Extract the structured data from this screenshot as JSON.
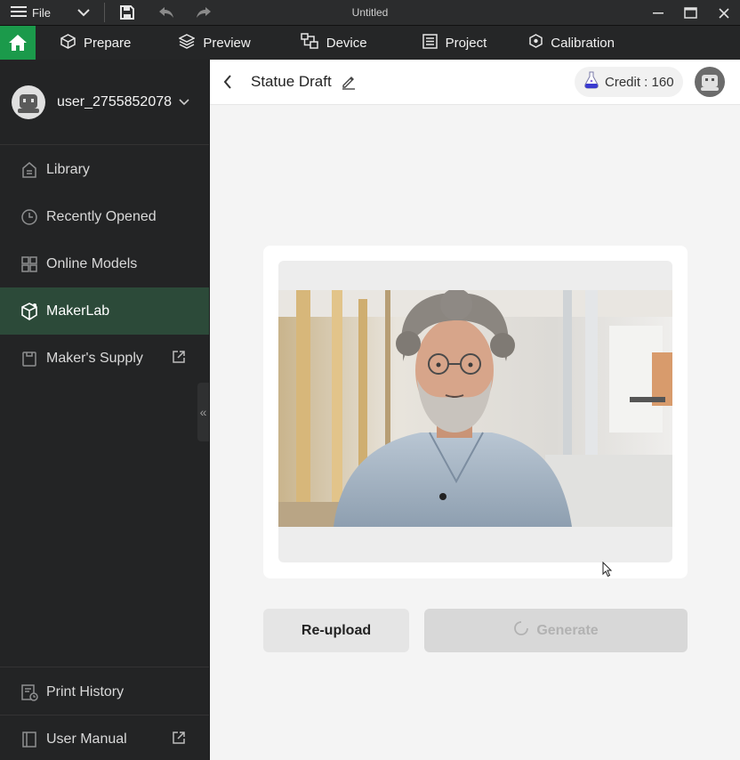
{
  "titlebar": {
    "file_label": "File",
    "title": "Untitled",
    "icons": [
      "menu-icon",
      "chevron-down-icon",
      "save-icon",
      "undo-icon",
      "redo-icon",
      "minimize-icon",
      "maximize-icon",
      "close-icon"
    ]
  },
  "tabs": [
    {
      "label": "Prepare",
      "icon": "cube-icon"
    },
    {
      "label": "Preview",
      "icon": "layers-icon"
    },
    {
      "label": "Device",
      "icon": "device-icon"
    },
    {
      "label": "Project",
      "icon": "list-icon"
    },
    {
      "label": "Calibration",
      "icon": "calibration-icon"
    }
  ],
  "sidebar": {
    "username": "user_2755852078",
    "items": [
      {
        "label": "Library",
        "icon": "library-icon"
      },
      {
        "label": "Recently Opened",
        "icon": "clock-icon"
      },
      {
        "label": "Online Models",
        "icon": "grid-icon"
      },
      {
        "label": "MakerLab",
        "icon": "makerlab-icon",
        "active": true
      },
      {
        "label": "Maker's Supply",
        "icon": "bag-icon",
        "external": true
      }
    ],
    "bottom_items": [
      {
        "label": "Print History",
        "icon": "history-icon"
      },
      {
        "label": "User Manual",
        "icon": "book-icon",
        "external": true
      }
    ]
  },
  "main": {
    "title": "Statue Draft",
    "credit_label": "Credit : 160",
    "reupload_label": "Re-upload",
    "generate_label": "Generate"
  },
  "colors": {
    "accent": "#1b9a4b",
    "sidebar_active": "#2c4a39",
    "sidebar_bg": "#232425",
    "main_bg": "#f4f4f4"
  }
}
